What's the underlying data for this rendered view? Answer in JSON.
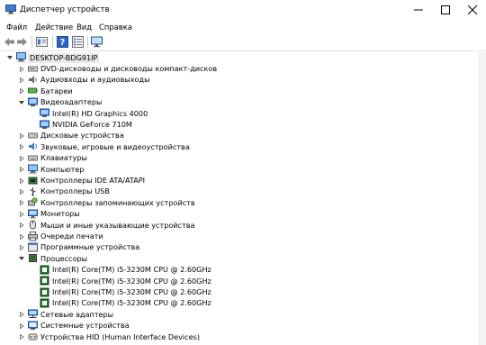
{
  "window": {
    "title": "Диспетчер устройств"
  },
  "menu": {
    "items": [
      "Файл",
      "Действие",
      "Вид",
      "Справка"
    ]
  },
  "tree": {
    "root": "DESKTOP-BDG91IP",
    "items": [
      {
        "label": "DVD-дисководы и дисководы компакт-дисков",
        "icon": "dvd-drive-icon"
      },
      {
        "label": "Аудиовходы и аудиовыходы",
        "icon": "speaker-icon"
      },
      {
        "label": "Батареи",
        "icon": "battery-icon"
      },
      {
        "label": "Видеоадаптеры",
        "icon": "display-adapter-icon",
        "expanded": true,
        "children": [
          "Intel(R) HD Graphics 4000",
          "NVIDIA GeForce 710M"
        ]
      },
      {
        "label": "Дисковые устройства",
        "icon": "disk-drive-icon"
      },
      {
        "label": "Звуковые, игровые и видеоустройства",
        "icon": "sound-icon"
      },
      {
        "label": "Клавиатуры",
        "icon": "keyboard-icon"
      },
      {
        "label": "Компьютер",
        "icon": "computer-icon"
      },
      {
        "label": "Контроллеры IDE ATA/ATAPI",
        "icon": "ide-controller-icon"
      },
      {
        "label": "Контроллеры USB",
        "icon": "usb-icon"
      },
      {
        "label": "Контроллеры запоминающих устройств",
        "icon": "storage-controller-icon"
      },
      {
        "label": "Мониторы",
        "icon": "monitor-icon"
      },
      {
        "label": "Мыши и иные указывающие устройства",
        "icon": "mouse-icon"
      },
      {
        "label": "Очереди печати",
        "icon": "printer-icon"
      },
      {
        "label": "Программные устройства",
        "icon": "software-device-icon"
      },
      {
        "label": "Процессоры",
        "icon": "processor-icon",
        "expanded": true,
        "children": [
          "Intel(R) Core(TM) i5-3230M CPU @ 2.60GHz",
          "Intel(R) Core(TM) i5-3230M CPU @ 2.60GHz",
          "Intel(R) Core(TM) i5-3230M CPU @ 2.60GHz",
          "Intel(R) Core(TM) i5-3230M CPU @ 2.60GHz"
        ]
      },
      {
        "label": "Сетевые адаптеры",
        "icon": "network-adapter-icon"
      },
      {
        "label": "Системные устройства",
        "icon": "system-device-icon"
      },
      {
        "label": "Устройства HID (Human Interface Devices)",
        "icon": "hid-icon"
      }
    ]
  },
  "colors": {
    "accent": "#2b64c4",
    "text": "#000000",
    "selection": "#e8e8e8"
  }
}
